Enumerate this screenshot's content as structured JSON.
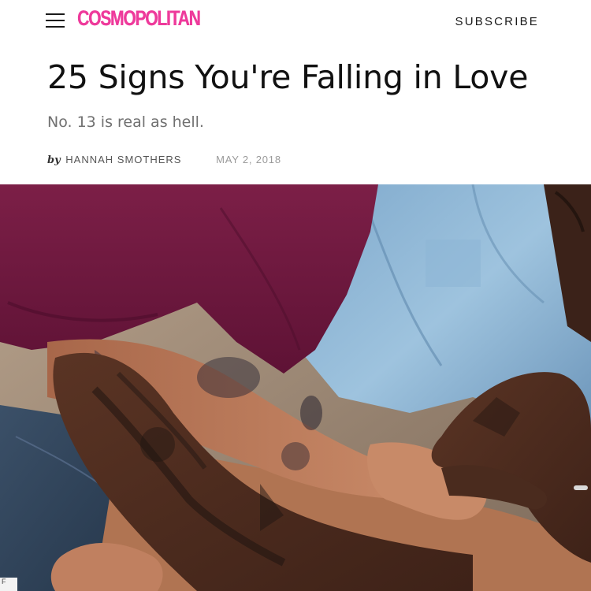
{
  "header": {
    "menu_icon": "hamburger-menu-icon",
    "logo_text": "COSMOPOLITAN",
    "subscribe_label": "SUBSCRIBE",
    "brand_color": "#ee3a9b"
  },
  "article": {
    "title": "25 Signs You're Falling in Love",
    "dek": "No. 13 is real as hell.",
    "byline_prefix": "by",
    "author": "HANNAH SMOTHERS",
    "date": "MAY 2, 2018"
  },
  "hero_image": {
    "corner_label": "F"
  }
}
